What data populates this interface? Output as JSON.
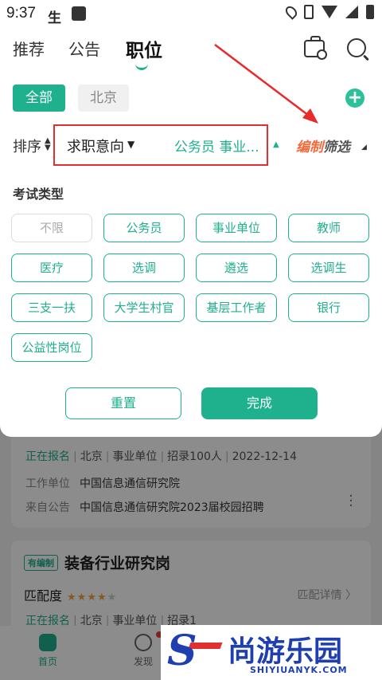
{
  "status_bar": {
    "time": "9:37",
    "app_icon": "生"
  },
  "top_tabs": [
    {
      "label": "推荐"
    },
    {
      "label": "公告"
    },
    {
      "label": "职位"
    }
  ],
  "regions": [
    {
      "label": "全部"
    },
    {
      "label": "北京"
    }
  ],
  "sort_row": {
    "sort_label": "排序",
    "intent_label": "求职意向",
    "intent_value": "公务员 事业...",
    "filter_part1": "编制",
    "filter_part2": "筛选"
  },
  "filter_section": {
    "title": "考试类型",
    "options": [
      {
        "label": "不限"
      },
      {
        "label": "公务员"
      },
      {
        "label": "事业单位"
      },
      {
        "label": "教师"
      },
      {
        "label": "医疗"
      },
      {
        "label": "选调"
      },
      {
        "label": "遴选"
      },
      {
        "label": "选调生"
      },
      {
        "label": "三支一扶"
      },
      {
        "label": "大学生村官"
      },
      {
        "label": "基层工作者"
      },
      {
        "label": "银行"
      },
      {
        "label": "公益性岗位"
      }
    ],
    "reset_label": "重置",
    "done_label": "完成"
  },
  "job_card_1": {
    "status": "正在报名",
    "city": "北京",
    "type": "事业单位",
    "recruit": "招录100人",
    "date": "2022-12-14",
    "employer_key": "工作单位",
    "employer": "中国信息通信研究院",
    "source_key": "来自公告",
    "source": "中国信息通信研究院2023届校园招聘"
  },
  "job_card_2": {
    "tag": "有编制",
    "title": "装备行业研究岗",
    "match_label": "匹配度",
    "stars": "★★★★",
    "stars_off": "★",
    "detail_link": "匹配详情 〉",
    "status": "正在报名",
    "city": "北京",
    "type": "事业单位",
    "recruit": "招录1"
  },
  "bottom_nav": [
    {
      "label": "首页"
    },
    {
      "label": "发现"
    }
  ],
  "watermark": {
    "text": "尚游乐园",
    "url": "SHIYIUANYK.COM"
  },
  "colors": {
    "accent": "#1fb08e",
    "highlight_box": "#e03030",
    "filter_orange": "#f06a3c"
  }
}
